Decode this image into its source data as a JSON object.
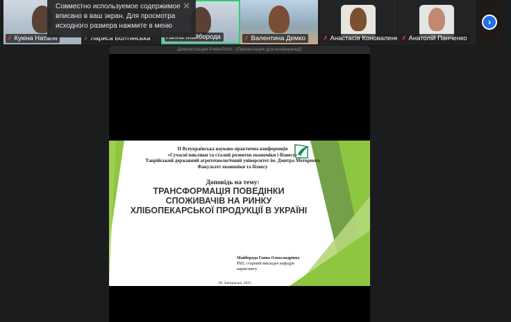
{
  "participants": [
    {
      "name": "Кукіна Наталя",
      "muted": true,
      "type": "video"
    },
    {
      "name": "Лариса Болтянська",
      "muted": true,
      "type": "off"
    },
    {
      "name": "Ганна Майборода",
      "muted": false,
      "type": "video",
      "active": true
    },
    {
      "name": "Валентина Демко",
      "muted": true,
      "type": "video"
    },
    {
      "name": "Анастасія Коноваленко",
      "muted": true,
      "type": "photo"
    },
    {
      "name": "Анатолій Панченко",
      "muted": true,
      "type": "photo"
    }
  ],
  "tooltip": {
    "text": "Совместно используемое содержимое вписано в ваш экран. Для просмотра исходного размера нажмите в меню",
    "close": "✕"
  },
  "next_button": "›",
  "share": {
    "title": "Демонстрация PowerPoint - [Презентация для конференції]"
  },
  "slide": {
    "line1": "II Всеукраїнська науково-практична конференція",
    "line2": "«Сучасні виклики та сталий розвиток економіки і бізнесу»",
    "line3": "Таврійський державний агротехнологічний університет ім. Дмитра Моторного",
    "line4": "Факультет економіки та бізнесу",
    "topic": "Доповідь на тему:",
    "title": "ТРАНСФОРМАЦІЯ ПОВЕДІНКИ СПОЖИВАЧІВ НА РИНКУ ХЛІБОПЕКАРСЬКОЇ ПРОДУКЦІЇ В УКРАЇНІ",
    "author": "Майборода Ганна Олександрівна",
    "position1": "PhD, старший викладач кафедри",
    "position2": "маркетингу",
    "city": "М. Запоріжжя, 2025."
  },
  "colors": {
    "accent_green": "#8dc63f",
    "active_border": "#2ecc71",
    "button_blue": "#1f6feb"
  }
}
